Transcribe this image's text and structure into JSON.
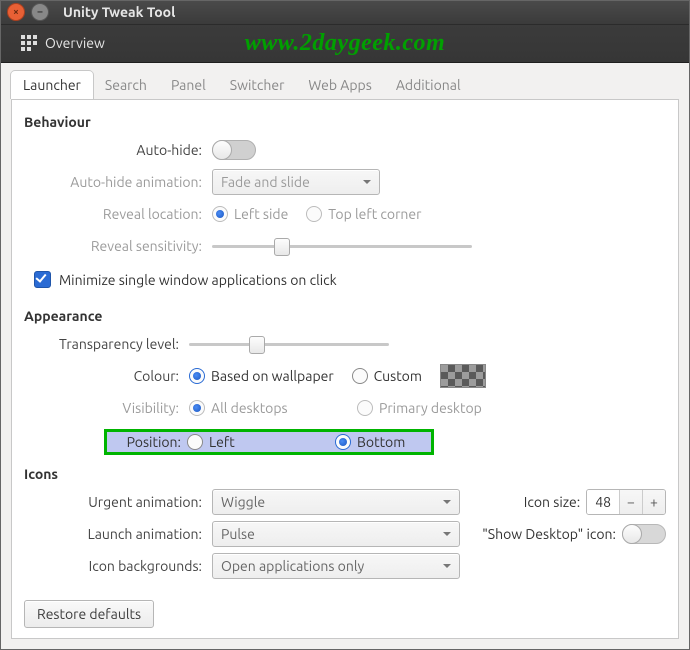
{
  "window": {
    "title": "Unity Tweak Tool"
  },
  "toolbar": {
    "overview_label": "Overview"
  },
  "watermark": "www.2daygeek.com",
  "tabs": [
    "Launcher",
    "Search",
    "Panel",
    "Switcher",
    "Web Apps",
    "Additional"
  ],
  "active_tab": 0,
  "sections": {
    "behaviour": {
      "title": "Behaviour",
      "autohide_label": "Auto-hide:",
      "autohide": false,
      "autohide_anim_label": "Auto-hide animation:",
      "autohide_anim_value": "Fade and slide",
      "reveal_location_label": "Reveal location:",
      "reveal_location_options": [
        "Left side",
        "Top left corner"
      ],
      "reveal_location_selected": 0,
      "reveal_sensitivity_label": "Reveal sensitivity:",
      "reveal_sensitivity_value": 0.25,
      "minimize_label": "Minimize single window applications on click",
      "minimize_checked": true
    },
    "appearance": {
      "title": "Appearance",
      "transparency_label": "Transparency level:",
      "transparency_value": 0.3,
      "colour_label": "Colour:",
      "colour_options": [
        "Based on wallpaper",
        "Custom"
      ],
      "colour_selected": 0,
      "visibility_label": "Visibility:",
      "visibility_options": [
        "All desktops",
        "Primary desktop"
      ],
      "visibility_selected": 0,
      "position_label": "Position:",
      "position_options": [
        "Left",
        "Bottom"
      ],
      "position_selected": 1
    },
    "icons": {
      "title": "Icons",
      "urgent_anim_label": "Urgent animation:",
      "urgent_anim_value": "Wiggle",
      "launch_anim_label": "Launch animation:",
      "launch_anim_value": "Pulse",
      "icon_bg_label": "Icon backgrounds:",
      "icon_bg_value": "Open applications only",
      "icon_size_label": "Icon size:",
      "icon_size_value": "48",
      "show_desktop_label": "\"Show Desktop\" icon:",
      "show_desktop_on": false
    }
  },
  "restore_label": "Restore defaults"
}
